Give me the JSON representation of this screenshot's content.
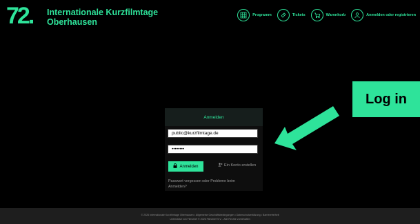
{
  "brand": {
    "logo_number": "72.",
    "name_line1": "Internationale Kurzfilmtage",
    "name_line2": "Oberhausen",
    "accent_color": "#2ee39a"
  },
  "nav": [
    {
      "label": "Programm",
      "icon": "grid-icon"
    },
    {
      "label": "Tickets",
      "icon": "ticket-icon"
    },
    {
      "label": "Warenkorb",
      "icon": "cart-icon"
    },
    {
      "label": "Anmelden oder registrieren",
      "icon": "user-icon"
    }
  ],
  "login": {
    "title": "Anmelden",
    "email_value": "public@kurzfilmtage.de",
    "password_value": "••••••••",
    "submit_label": "Anmelden",
    "create_account_label": "Ein Konto erstellen",
    "forgot_label": "Passwort vergessen oder Probleme beim Anmelden?"
  },
  "callout": {
    "text": "Log in"
  },
  "footer": {
    "line1": "© 2026 Internationale Kurzfilmtage Oberhausen • Allgemeine Geschäftsbedingungen • Datenschutzerklärung • Barrierefreiheit",
    "line2": "Unterstützt von Filmchief © 2026 Filmchief S.V. - Alle Rechte vorbehalten"
  }
}
